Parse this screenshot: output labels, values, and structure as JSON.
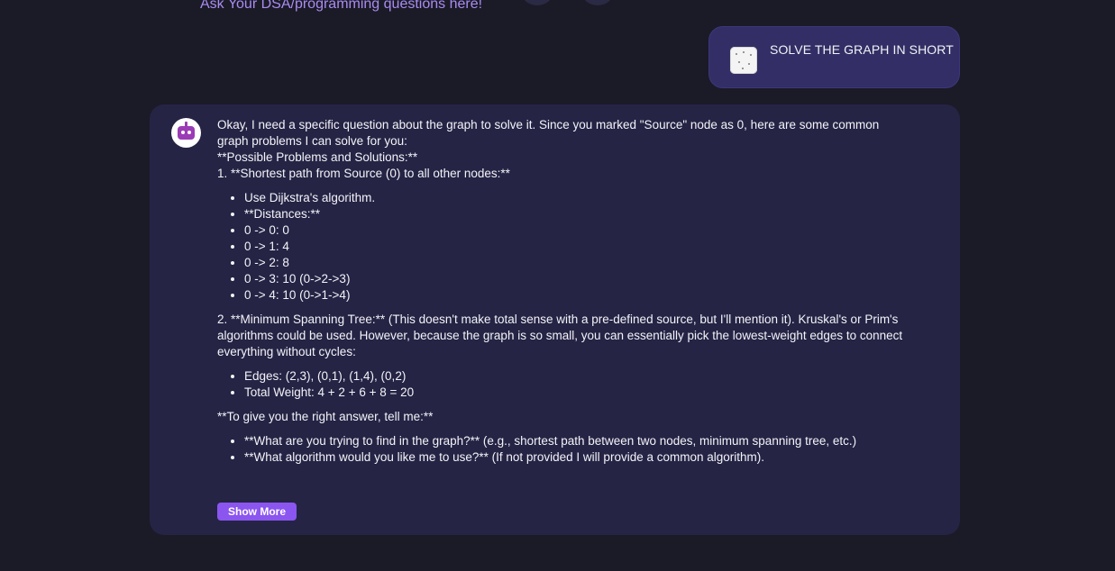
{
  "header": {
    "hint": "Ask Your DSA/programming questions here!"
  },
  "user_message": {
    "text": "SOLVE THE GRAPH IN SHORT",
    "attachment_icon": "image-thumbnail-icon"
  },
  "bot_message": {
    "avatar_icon": "robot-avatar-icon",
    "intro_line1": "Okay, I need a specific question about the graph to solve it. Since you marked \"Source\" node as 0, here are some common",
    "intro_line2": "graph problems I can solve for you:",
    "possible_heading": "**Possible Problems and Solutions:**",
    "item1_heading": "1. **Shortest path from Source (0) to all other nodes:**",
    "item1_bullets": [
      "Use Dijkstra's algorithm.",
      "**Distances:**",
      "0 -> 0: 0",
      "0 -> 1: 4",
      "0 -> 2: 8",
      "0 -> 3: 10 (0->2->3)",
      "0 -> 4: 10 (0->1->4)"
    ],
    "item2_text": "2. **Minimum Spanning Tree:** (This doesn't make total sense with a pre-defined source, but I'll mention it). Kruskal's or Prim's algorithms could be used. However, because the graph is so small, you can essentially pick the lowest-weight edges to connect everything without cycles:",
    "item2_bullets": [
      "Edges: (2,3), (0,1), (1,4), (0,2)",
      "Total Weight: 4 + 2 + 6 + 8 = 20"
    ],
    "closing_heading": "**To give you the right answer, tell me:**",
    "closing_bullets": [
      "**What are you trying to find in the graph?** (e.g., shortest path between two nodes, minimum spanning tree, etc.)",
      "**What algorithm would you like me to use?** (If not provided I will provide a common algorithm)."
    ],
    "show_more_label": "Show More"
  },
  "colors": {
    "background": "#1b1a27",
    "bot_card": "#252445",
    "user_bubble": "#332f66",
    "accent": "#8b55ef",
    "hint_text": "#a98cf0"
  }
}
